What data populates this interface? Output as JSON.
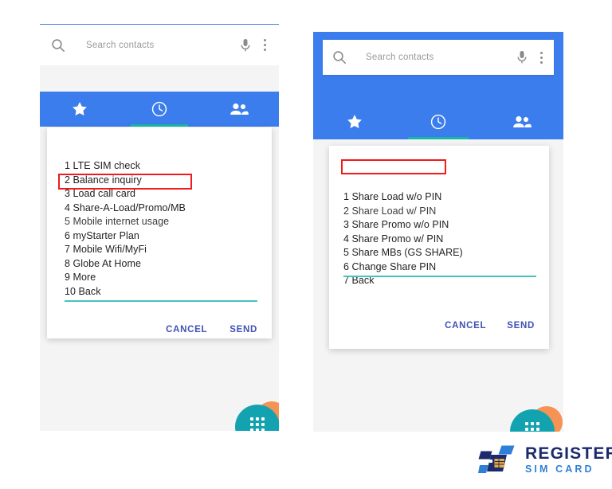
{
  "page": {
    "background": "#ffffff",
    "accent_blue": "#3b7ded",
    "accent_teal": "#13a3b0",
    "divider_teal": "#44c4bb",
    "highlight_red": "#ee1c1c",
    "action_blue": "#3f51b5"
  },
  "phones": [
    {
      "id": "left",
      "search": {
        "placeholder": "Search contacts",
        "search_icon": "search-icon",
        "mic_icon": "microphone-icon",
        "overflow_icon": "overflow-menu-icon"
      },
      "tabs": [
        {
          "name": "favorites",
          "icon": "star-icon",
          "selected": false
        },
        {
          "name": "recents",
          "icon": "clock-icon",
          "selected": true
        },
        {
          "name": "contacts",
          "icon": "people-icon",
          "selected": false
        }
      ],
      "dialog": {
        "items": [
          "1 LTE SIM check",
          "2 Balance inquiry",
          "3 Load call card",
          "4 Share-A-Load/Promo/MB",
          "5 Mobile internet usage",
          "6 myStarter Plan",
          "7 Mobile Wifi/MyFi",
          "8 Globe At Home",
          "9 More",
          "10 Back"
        ],
        "highlighted_index": 3,
        "cancel_label": "CANCEL",
        "send_label": "SEND"
      },
      "fab": {
        "icon": "dialpad-icon"
      }
    },
    {
      "id": "right",
      "search": {
        "placeholder": "Search contacts",
        "search_icon": "search-icon",
        "mic_icon": "microphone-icon",
        "overflow_icon": "overflow-menu-icon"
      },
      "tabs": [
        {
          "name": "favorites",
          "icon": "star-icon",
          "selected": false
        },
        {
          "name": "recents",
          "icon": "clock-icon",
          "selected": true
        },
        {
          "name": "contacts",
          "icon": "people-icon",
          "selected": false
        }
      ],
      "dialog": {
        "items": [
          "1 Share Load w/o PIN",
          "2 Share Load w/ PIN",
          "3 Share Promo w/o PIN",
          "4 Share Promo w/ PIN",
          "5 Share MBs (GS SHARE)",
          "6 Change Share PIN",
          "7 Back"
        ],
        "highlighted_index": 0,
        "cancel_label": "CANCEL",
        "send_label": "SEND"
      },
      "fab": {
        "icon": "dialpad-icon"
      }
    }
  ],
  "logo": {
    "icon": "sim-card-icon",
    "title": "REGISTER",
    "subtitle": "SIM CARD"
  }
}
